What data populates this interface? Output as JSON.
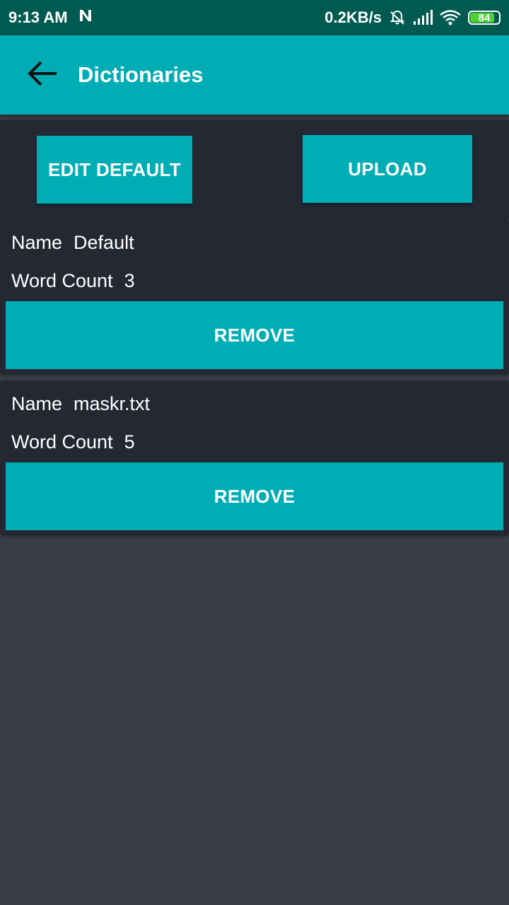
{
  "status_bar": {
    "time": "9:13 AM",
    "network_speed": "0.2KB/s",
    "battery_level": "84",
    "icons": [
      "notification-n-icon",
      "mute-bell-icon",
      "signal-icon",
      "wifi-icon",
      "battery-icon"
    ],
    "battery_color": "#4cd137"
  },
  "app_bar": {
    "title": "Dictionaries",
    "back_icon": "arrow-left-icon"
  },
  "actions": {
    "edit_default_label": "EDIT DEFAULT",
    "upload_label": "UPLOAD"
  },
  "dictionaries": [
    {
      "name_label": "Name",
      "name": "Default",
      "count_label": "Word Count",
      "count": "3",
      "remove_label": "REMOVE"
    },
    {
      "name_label": "Name",
      "name": "maskr.txt",
      "count_label": "Word Count",
      "count": "5",
      "remove_label": "REMOVE"
    }
  ],
  "colors": {
    "accent": "#00adb5",
    "status_bar": "#005a4f",
    "card": "#232833",
    "background": "#393d46"
  }
}
